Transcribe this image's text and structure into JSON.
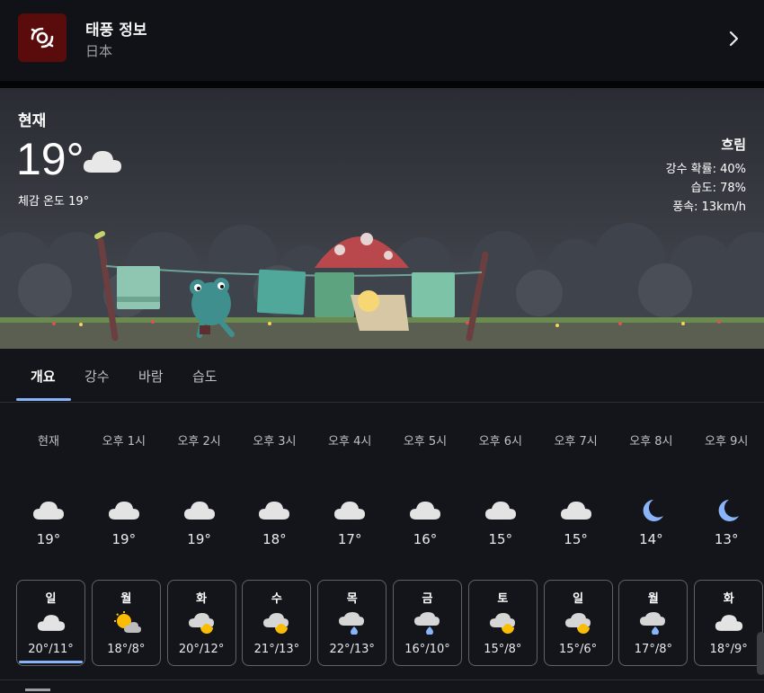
{
  "typhoon": {
    "title": "태풍 정보",
    "subtitle": "日本"
  },
  "current": {
    "label": "현재",
    "temp": "19°",
    "feels_like": "체감 온도 19°",
    "condition": "흐림",
    "details": [
      "강수 확률: 40%",
      "습도: 78%",
      "풍속: 13km/h"
    ]
  },
  "tabs": [
    "개요",
    "강수",
    "바람",
    "습도"
  ],
  "hourly": [
    {
      "time": "현재",
      "temp": "19°",
      "icon": "cloud-icon"
    },
    {
      "time": "오후 1시",
      "temp": "19°",
      "icon": "cloud-icon"
    },
    {
      "time": "오후 2시",
      "temp": "19°",
      "icon": "cloud-icon"
    },
    {
      "time": "오후 3시",
      "temp": "18°",
      "icon": "cloud-icon"
    },
    {
      "time": "오후 4시",
      "temp": "17°",
      "icon": "cloud-icon"
    },
    {
      "time": "오후 5시",
      "temp": "16°",
      "icon": "cloud-icon"
    },
    {
      "time": "오후 6시",
      "temp": "15°",
      "icon": "cloud-icon"
    },
    {
      "time": "오후 7시",
      "temp": "15°",
      "icon": "cloud-icon"
    },
    {
      "time": "오후 8시",
      "temp": "14°",
      "icon": "moon-icon"
    },
    {
      "time": "오후 9시",
      "temp": "13°",
      "icon": "moon-icon"
    }
  ],
  "daily": [
    {
      "day": "일",
      "temp": "20°/11°",
      "icon": "cloud-icon"
    },
    {
      "day": "월",
      "temp": "18°/8°",
      "icon": "sun-cloud-icon"
    },
    {
      "day": "화",
      "temp": "20°/12°",
      "icon": "cloud-sun-icon"
    },
    {
      "day": "수",
      "temp": "21°/13°",
      "icon": "cloud-sun-icon"
    },
    {
      "day": "목",
      "temp": "22°/13°",
      "icon": "cloud-rain-icon"
    },
    {
      "day": "금",
      "temp": "16°/10°",
      "icon": "cloud-rain-icon"
    },
    {
      "day": "토",
      "temp": "15°/8°",
      "icon": "cloud-sun-icon"
    },
    {
      "day": "일",
      "temp": "15°/6°",
      "icon": "cloud-sun-icon"
    },
    {
      "day": "월",
      "temp": "17°/8°",
      "icon": "cloud-rain-icon"
    },
    {
      "day": "화",
      "temp": "18°/9°",
      "icon": "cloud-icon"
    }
  ],
  "colors": {
    "accent": "#8ab4f8",
    "background": "#14151a",
    "moon": "#8ab4f8",
    "sun": "#fbbc04"
  }
}
